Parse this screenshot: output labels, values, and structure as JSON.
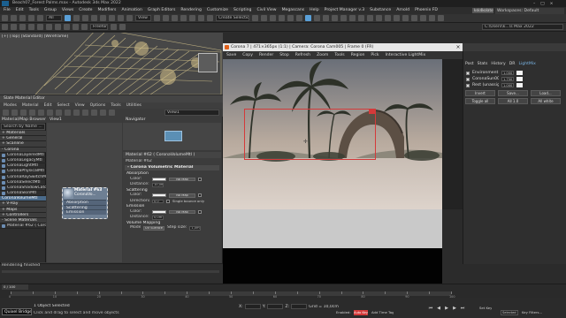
{
  "app": {
    "title": "Beach07_Forest Palms.max - Autodesk 3ds Max 2022",
    "workspaces_label": "Workspaces:",
    "workspace_value": "Default",
    "user": "ksk4kolatova"
  },
  "menubar": [
    "File",
    "Edit",
    "Tools",
    "Group",
    "Views",
    "Create",
    "Modifiers",
    "Animation",
    "Graph Editors",
    "Rendering",
    "Customize",
    "Scripting",
    "Civil View",
    "Megascans",
    "Help",
    "Project Manager v.3",
    "Substance",
    "Arnold",
    "Phoenix FD"
  ],
  "toolbar": {
    "create_selection_set": "Create Selection Se",
    "selection_filter": "All",
    "view_mode": "View",
    "freeform_tab": "Freeform",
    "drive_path": "C:\\Users\\k...\\s Max 2022"
  },
  "viewport": {
    "label": "[+] [Top] [Standard] [Wireframe]"
  },
  "slate_material_editor": {
    "title": "Slate Material Editor",
    "menu": [
      "Modes",
      "Material",
      "Edit",
      "Select",
      "View",
      "Options",
      "Tools",
      "Utilities"
    ],
    "browser_title": "Material/Map Browser",
    "browser_search": "Search by Name ...",
    "browser_items": [
      {
        "label": "+ Materials",
        "kind": "cat"
      },
      {
        "label": "+ General",
        "kind": "cat"
      },
      {
        "label": "+ Scanline",
        "kind": "cat"
      },
      {
        "label": "- Corona",
        "kind": "cat"
      },
      {
        "label": "CoronaLayeredMtl",
        "kind": "mat"
      },
      {
        "label": "CoronaLegacyMtl",
        "kind": "mat"
      },
      {
        "label": "CoronaLightMtl",
        "kind": "mat"
      },
      {
        "label": "CoronaPhysicalMtl",
        "kind": "mat"
      },
      {
        "label": "CoronaRaySwitchMtl",
        "kind": "mat"
      },
      {
        "label": "CoronaSelectMtl",
        "kind": "mat"
      },
      {
        "label": "CoronaShadowCatcherMtl",
        "kind": "mat"
      },
      {
        "label": "CoronaSkinMtl",
        "kind": "mat"
      },
      {
        "label": "CoronaVolumeMtl",
        "kind": "sel"
      },
      {
        "label": "+ V-Ray",
        "kind": "cat"
      },
      {
        "label": "+ Maps",
        "kind": "cat"
      },
      {
        "label": "+ Controllers",
        "kind": "cat"
      },
      {
        "label": "- Scene Materials",
        "kind": "cat"
      },
      {
        "label": "Material #62 ( CoronaVolumeMtl )",
        "kind": "mat"
      }
    ],
    "view_tab": "View1",
    "navigator_title": "Navigator",
    "node": {
      "title": "Material #63",
      "subtitle": "CoronaVo...",
      "slots": [
        "Absorption",
        "Scattering",
        "Emission"
      ]
    },
    "params_title": "Material #62 ( CoronaVolumeMtl )",
    "params_sub": "Material #62",
    "rollout_title": "- Corona Volumetric Material",
    "absorption_label": "Absorption",
    "absorption_color_label": "Color:",
    "absorption_distance_label": "Distance:",
    "absorption_distance": "10,0m",
    "absorption_map": "No Map",
    "scattering_label": "Scattering",
    "scattering_color_label": "Color:",
    "scattering_map": "No Map",
    "directionality_label": "Directionality:",
    "directionality": "0,0",
    "single_bounce_label": "Single bounce only",
    "emission_label": "Emission",
    "emission_color_label": "Color:",
    "emission_map": "No Map",
    "emission_distance_label": "Distance:",
    "emission_distance": "0,0m",
    "volume_mapping_label": "Volume Mapping",
    "mode_label": "Mode:",
    "mode_value": "UV Surface",
    "step_size_label": "Step size:",
    "step_size": "1,0m",
    "rendering_finished": "Rendering finished"
  },
  "vfb": {
    "title": "Corona 7 | 471×365px (1:1) | Camera: Corona Cam005 | Frame 0 (FR)",
    "toolbar": [
      "Save",
      "Copy",
      "Render",
      "Stop",
      "Refresh",
      "Zoom",
      "Tools",
      "Region",
      "Pick",
      "Interactive LightMix"
    ],
    "tabs": [
      "Post",
      "Stats",
      "History",
      "DR",
      "LightMix"
    ],
    "layers": [
      {
        "name": "Environment",
        "value": "1.000"
      },
      {
        "name": "CoronaSun001",
        "value": "1.750"
      },
      {
        "name": "Rest (unassigned)",
        "value": "1.000"
      }
    ],
    "buttons_row1": [
      "Invert",
      "Save...",
      "Load..."
    ],
    "buttons_row2": [
      "Toggle all",
      "All 1.0",
      "All white"
    ]
  },
  "timeline": {
    "frame": "0 / 100",
    "ticks": [
      0,
      5,
      10,
      15,
      20,
      25,
      30,
      35,
      40,
      45,
      50,
      55,
      60,
      65,
      70,
      75,
      80,
      85,
      90,
      95,
      100
    ]
  },
  "statusbar": {
    "script_label": "Quixel Bridge",
    "selected_count": "1 Object Selected",
    "hint": "Click and drag to select and move objects",
    "x_label": "X:",
    "y_label": "Y:",
    "z_label": "Z:",
    "grid": "Grid = 10,0cm",
    "enabled_label": "Enabled:",
    "add_time_tag": "Add Time Tag",
    "auto_key": "Auto Key",
    "selected_mode": "Selected",
    "set_key": "Set Key",
    "key_filters": "Key Filters..."
  }
}
